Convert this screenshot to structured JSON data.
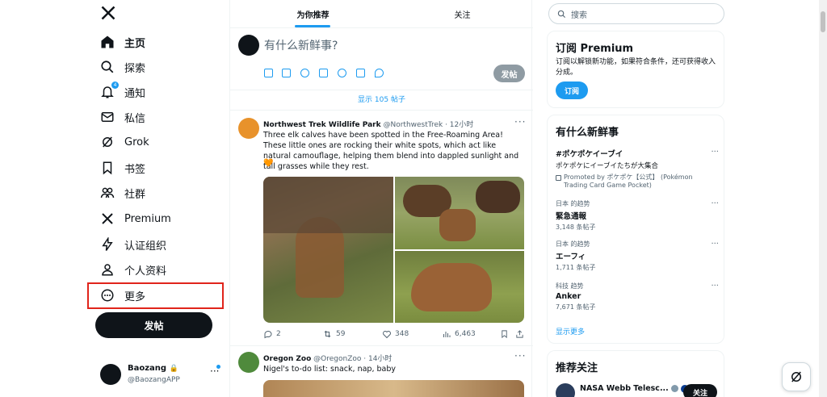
{
  "sidebar": {
    "logo": "X",
    "items": [
      {
        "label": "主页",
        "icon": "home-icon"
      },
      {
        "label": "探索",
        "icon": "search-icon"
      },
      {
        "label": "通知",
        "icon": "bell-icon",
        "badge": "4"
      },
      {
        "label": "私信",
        "icon": "envelope-icon"
      },
      {
        "label": "Grok",
        "icon": "grok-icon"
      },
      {
        "label": "书签",
        "icon": "bookmark-icon"
      },
      {
        "label": "社群",
        "icon": "people-icon"
      },
      {
        "label": "Premium",
        "icon": "x-icon"
      },
      {
        "label": "认证组织",
        "icon": "lightning-icon"
      },
      {
        "label": "个人资料",
        "icon": "person-icon"
      },
      {
        "label": "更多",
        "icon": "more-circle-icon"
      }
    ],
    "post_button": "发帖",
    "account": {
      "name": "Baozang",
      "handle": "@BaozangAPP"
    }
  },
  "main": {
    "tabs": [
      "为你推荐",
      "关注"
    ],
    "compose_placeholder": "有什么新鲜事?",
    "compose_post": "发帖",
    "show_more": "显示 105 帖子",
    "tweets": [
      {
        "name": "Northwest Trek Wildlife Park",
        "handle": "@NorthwestTrek",
        "time": "· 12小时",
        "text": "Three elk calves have been spotted in the Free-Roaming Area! These little ones are rocking their white spots, which act like natural camouflage, helping them blend into dappled sunlight and tall grasses while they rest.",
        "emoji": "🧡",
        "replies": "2",
        "retweets": "59",
        "likes": "348",
        "views": "6,463"
      },
      {
        "name": "Oregon Zoo",
        "handle": "@OregonZoo",
        "time": "· 14小时",
        "text": "Nigel's to-do list: snack, nap, baby"
      }
    ]
  },
  "right": {
    "search_placeholder": "搜索",
    "premium": {
      "title": "订阅 Premium",
      "desc": "订阅以解锁新功能，如果符合条件，还可获得收入分成。",
      "button": "订阅"
    },
    "trends_title": "有什么新鲜事",
    "trends": [
      {
        "meta": "#ポケポケイーブイ",
        "name": "ポケポケにイーブイたちが大集合",
        "promo": "Promoted by ポケポケ【公式】 (Pokémon Trading Card Game Pocket)"
      },
      {
        "meta": "日本 的趋势",
        "name": "緊急通報",
        "count": "3,148 条帖子"
      },
      {
        "meta": "日本 的趋势",
        "name": "エーフィ",
        "count": "1,711 条帖子"
      },
      {
        "meta": "科技 趋势",
        "name": "Anker",
        "count": "7,671 条帖子"
      }
    ],
    "show_more": "显示更多",
    "who_to_follow": "推荐关注",
    "follow_name": "NASA Webb Telesc...",
    "follow_button": "关注"
  }
}
